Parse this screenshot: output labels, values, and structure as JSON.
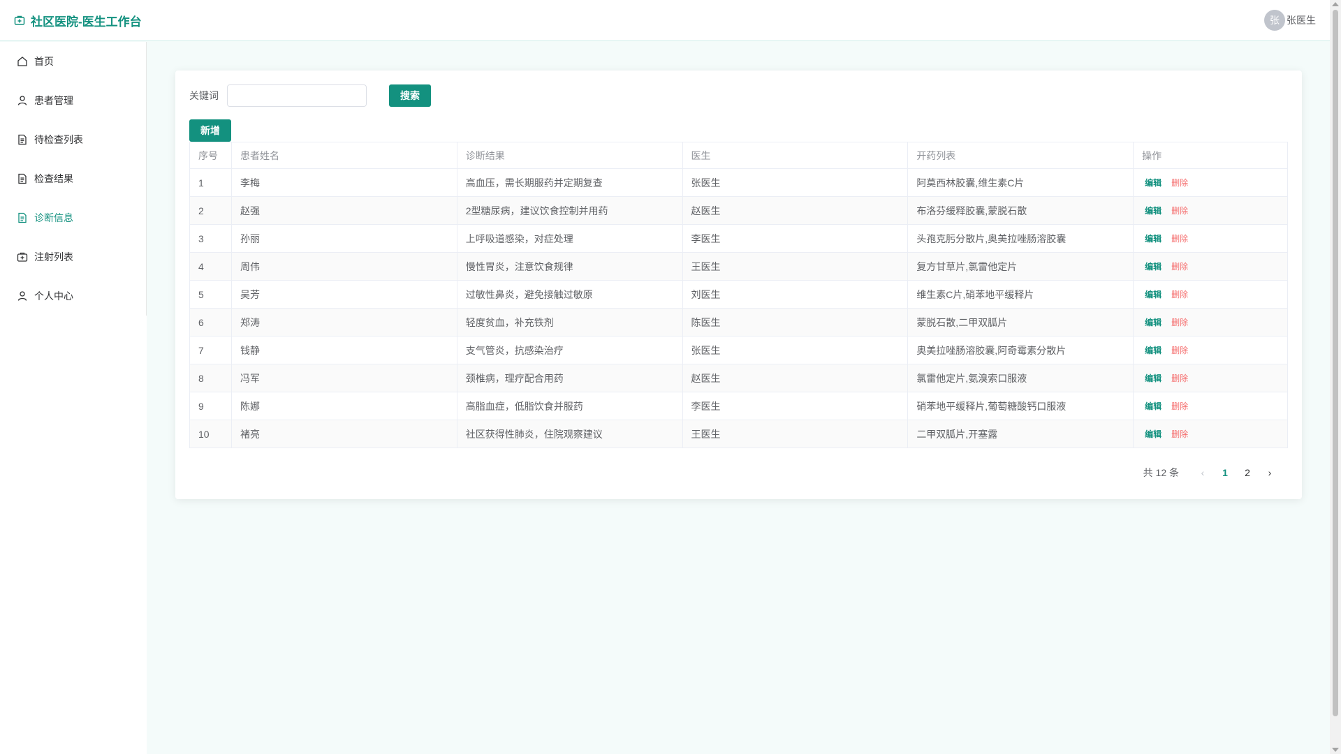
{
  "header": {
    "title": "社区医院-医生工作台",
    "avatar_char": "张",
    "username": "张医生"
  },
  "sidebar": {
    "items": [
      {
        "label": "首页",
        "icon": "home-icon"
      },
      {
        "label": "患者管理",
        "icon": "user-icon"
      },
      {
        "label": "待检查列表",
        "icon": "document-icon"
      },
      {
        "label": "检查结果",
        "icon": "document-icon"
      },
      {
        "label": "诊断信息",
        "icon": "document-icon",
        "active": true
      },
      {
        "label": "注射列表",
        "icon": "medical-kit-icon"
      },
      {
        "label": "个人中心",
        "icon": "user-icon"
      }
    ]
  },
  "search": {
    "label": "关键词",
    "value": "",
    "placeholder": "",
    "button": "搜索"
  },
  "add_button": "新增",
  "table": {
    "columns": [
      "序号",
      "患者姓名",
      "诊断结果",
      "医生",
      "开药列表",
      "操作"
    ],
    "rows": [
      [
        "1",
        "李梅",
        "高血压，需长期服药并定期复查",
        "张医生",
        "阿莫西林胶囊,维生素C片"
      ],
      [
        "2",
        "赵强",
        "2型糖尿病，建议饮食控制并用药",
        "赵医生",
        "布洛芬缓释胶囊,蒙脱石散"
      ],
      [
        "3",
        "孙丽",
        "上呼吸道感染，对症处理",
        "李医生",
        "头孢克肟分散片,奥美拉唑肠溶胶囊"
      ],
      [
        "4",
        "周伟",
        "慢性胃炎，注意饮食规律",
        "王医生",
        "复方甘草片,氯雷他定片"
      ],
      [
        "5",
        "吴芳",
        "过敏性鼻炎，避免接触过敏原",
        "刘医生",
        "维生素C片,硝苯地平缓释片"
      ],
      [
        "6",
        "郑涛",
        "轻度贫血，补充铁剂",
        "陈医生",
        "蒙脱石散,二甲双胍片"
      ],
      [
        "7",
        "钱静",
        "支气管炎，抗感染治疗",
        "张医生",
        "奥美拉唑肠溶胶囊,阿奇霉素分散片"
      ],
      [
        "8",
        "冯军",
        "颈椎病，理疗配合用药",
        "赵医生",
        "氯雷他定片,氨溴索口服液"
      ],
      [
        "9",
        "陈娜",
        "高脂血症，低脂饮食并服药",
        "李医生",
        "硝苯地平缓释片,葡萄糖酸钙口服液"
      ],
      [
        "10",
        "褚亮",
        "社区获得性肺炎，住院观察建议",
        "王医生",
        "二甲双胍片,开塞露"
      ]
    ],
    "edit_label": "编辑",
    "delete_label": "删除"
  },
  "pagination": {
    "total_text": "共 12 条",
    "pages": [
      "1",
      "2"
    ],
    "current": "1"
  },
  "colors": {
    "accent": "#13917f",
    "danger": "#f56c6c",
    "background": "#f4fbfa"
  }
}
